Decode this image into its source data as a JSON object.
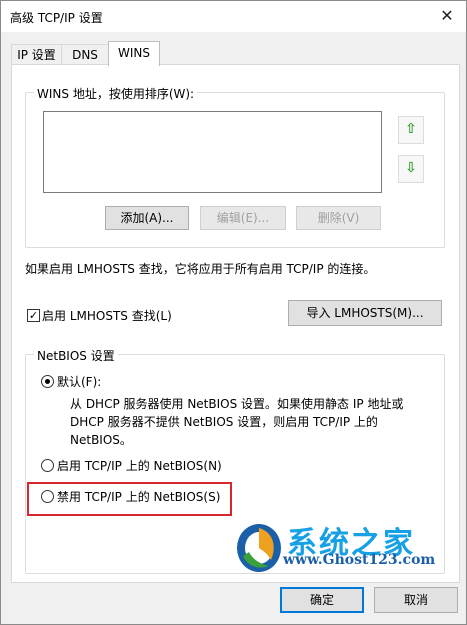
{
  "window": {
    "title": "高级 TCP/IP 设置",
    "close_glyph": "✕"
  },
  "tabs": [
    {
      "label": "IP 设置"
    },
    {
      "label": "DNS"
    },
    {
      "label": "WINS"
    }
  ],
  "wins": {
    "group_title": "WINS 地址，按使用排序(W):",
    "up_glyph": "⇧",
    "down_glyph": "⇩",
    "add_label": "添加(A)...",
    "edit_label": "编辑(E)...",
    "remove_label": "删除(V)"
  },
  "lmhosts": {
    "info_text": "如果启用 LMHOSTS 查找，它将应用于所有启用 TCP/IP 的连接。",
    "checkbox_label": "启用 LMHOSTS 查找(L)",
    "checkbox_mark": "✓",
    "checked": true,
    "import_label": "导入 LMHOSTS(M)..."
  },
  "netbios": {
    "group_title": "NetBIOS 设置",
    "default_label": "默认(F):",
    "default_desc_1": "从 DHCP 服务器使用 NetBIOS 设置。如果使用静态 IP 地址或",
    "default_desc_2": "DHCP 服务器不提供 NetBIOS 设置，则启用 TCP/IP 上的",
    "default_desc_3": "NetBIOS。",
    "enable_label": "启用 TCP/IP 上的 NetBIOS(N)",
    "disable_label": "禁用 TCP/IP 上的 NetBIOS(S)",
    "selected": "default",
    "highlight_color": "#d9262e"
  },
  "watermark": {
    "title": "系统之家",
    "url": "www.Ghost123.com"
  },
  "footer": {
    "ok_label": "确定",
    "cancel_label": "取消"
  }
}
